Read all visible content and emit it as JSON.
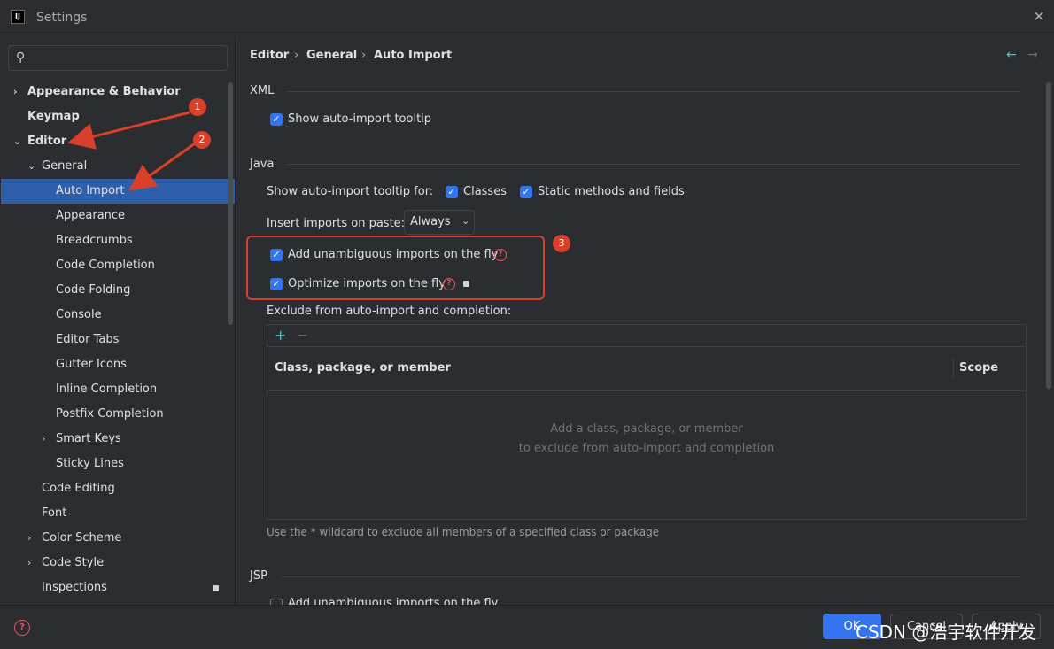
{
  "window": {
    "title": "Settings",
    "logo_text": "IJ"
  },
  "search": {
    "placeholder": "",
    "value": ""
  },
  "sidebar": {
    "items": [
      {
        "label": "Appearance & Behavior",
        "chevron": "›"
      },
      {
        "label": "Keymap",
        "chevron": ""
      },
      {
        "label": "Editor",
        "chevron": "⌄"
      },
      {
        "label": "General",
        "chevron": "⌄"
      },
      {
        "label": "Auto Import",
        "chevron": ""
      },
      {
        "label": "Appearance",
        "chevron": ""
      },
      {
        "label": "Breadcrumbs",
        "chevron": ""
      },
      {
        "label": "Code Completion",
        "chevron": ""
      },
      {
        "label": "Code Folding",
        "chevron": ""
      },
      {
        "label": "Console",
        "chevron": ""
      },
      {
        "label": "Editor Tabs",
        "chevron": ""
      },
      {
        "label": "Gutter Icons",
        "chevron": ""
      },
      {
        "label": "Inline Completion",
        "chevron": ""
      },
      {
        "label": "Postfix Completion",
        "chevron": ""
      },
      {
        "label": "Smart Keys",
        "chevron": "›"
      },
      {
        "label": "Sticky Lines",
        "chevron": ""
      },
      {
        "label": "Code Editing",
        "chevron": ""
      },
      {
        "label": "Font",
        "chevron": ""
      },
      {
        "label": "Color Scheme",
        "chevron": "›"
      },
      {
        "label": "Code Style",
        "chevron": "›"
      },
      {
        "label": "Inspections",
        "chevron": ""
      }
    ]
  },
  "breadcrumb": {
    "items": [
      "Editor",
      "General",
      "Auto Import"
    ],
    "separator": "›"
  },
  "nav": {
    "back": "←",
    "forward": "→"
  },
  "xml": {
    "title": "XML",
    "show_tooltip": "Show auto-import tooltip"
  },
  "java": {
    "title": "Java",
    "tooltip_for_label": "Show auto-import tooltip for:",
    "classes_label": "Classes",
    "static_label": "Static methods and fields",
    "paste_label": "Insert imports on paste:",
    "paste_value": "Always",
    "add_unambiguous": "Add unambiguous imports on the fly",
    "optimize": "Optimize imports on the fly",
    "exclude_label": "Exclude from auto-import and completion:"
  },
  "table": {
    "add": "+",
    "remove": "−",
    "col1": "Class, package, or member",
    "col2": "Scope",
    "empty_line1": "Add a class, package, or member",
    "empty_line2": "to exclude from auto-import and completion"
  },
  "hint": "Use the * wildcard to exclude all members of a specified class or package",
  "jsp": {
    "title": "JSP",
    "add_unambiguous": "Add unambiguous imports on the fly"
  },
  "annotations": {
    "n1": "1",
    "n2": "2",
    "n3": "3",
    "color": "#d9402b"
  },
  "footer": {
    "ok": "OK",
    "cancel": "Cancel",
    "apply": "Apply",
    "help": "?"
  },
  "watermark": "CSDN @浩宇软件开发",
  "colors": {
    "accent": "#3574f0",
    "selection": "#2e5fa8",
    "background": "#2b2d30",
    "help": "#e55765"
  }
}
